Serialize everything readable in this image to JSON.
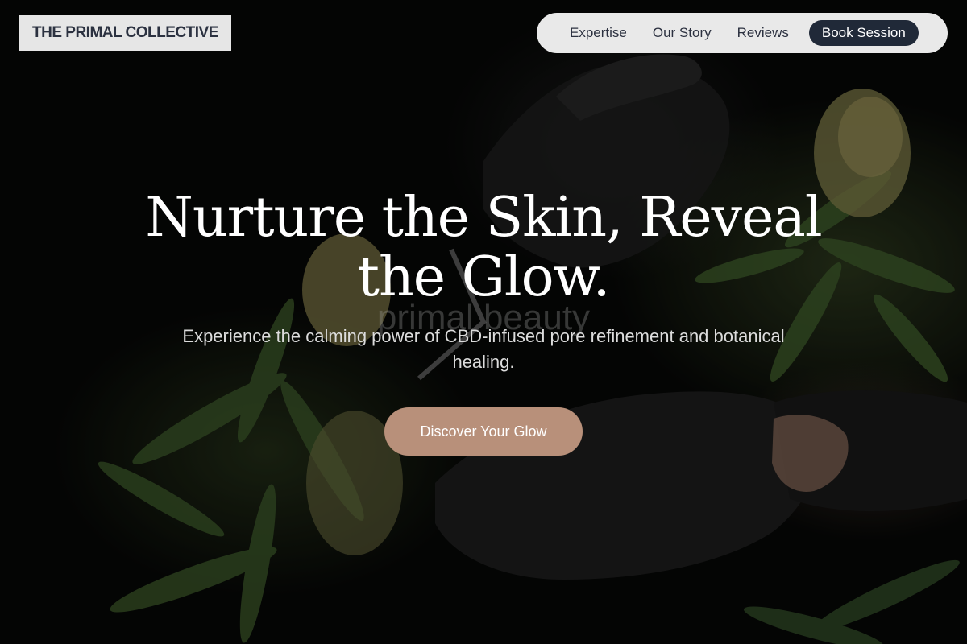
{
  "brand": {
    "name": "THE PRIMAL COLLECTIVE"
  },
  "nav": {
    "links": [
      {
        "label": "Expertise"
      },
      {
        "label": "Our Story"
      },
      {
        "label": "Reviews"
      }
    ],
    "cta_label": "Book Session"
  },
  "hero": {
    "headline": "Nurture the Skin, Reveal the Glow.",
    "watermark": "primal beauty",
    "subhead": "Experience the calming power of CBD-infused pore refinement and botanical healing.",
    "cta_label": "Discover Your Glow"
  },
  "colors": {
    "brand_box_bg": "#e6e6e6",
    "nav_bg": "#e9e9e9",
    "nav_cta_bg": "#202938",
    "hero_cta_bg": "#b8907a",
    "text_dark": "#2c3140"
  }
}
